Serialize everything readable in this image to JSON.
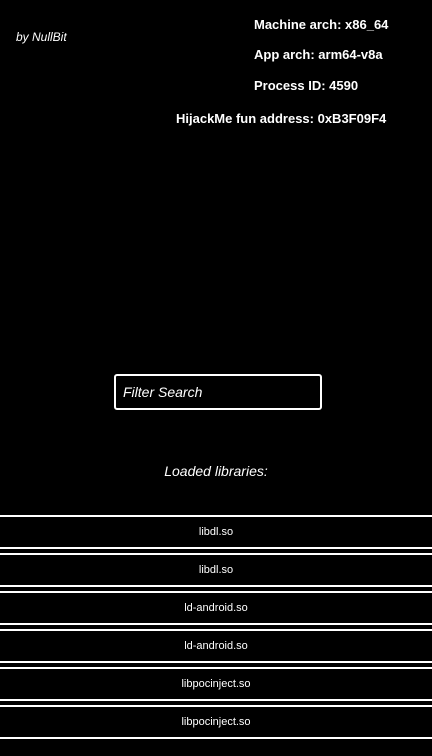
{
  "header": {
    "author": "by NullBit",
    "machine_arch": "Machine arch: x86_64",
    "app_arch": "App arch: arm64-v8a",
    "process_id": "Process ID: 4590",
    "hijack_address": "HijackMe fun address: 0xB3F09F4"
  },
  "search": {
    "placeholder": "Filter Search",
    "value": ""
  },
  "libraries": {
    "heading": "Loaded libraries:",
    "items": [
      "libdl.so",
      "libdl.so",
      "ld-android.so",
      "ld-android.so",
      "libpocinject.so",
      "libpocinject.so"
    ]
  },
  "colors": {
    "background": "#000000",
    "foreground": "#ffffff"
  }
}
